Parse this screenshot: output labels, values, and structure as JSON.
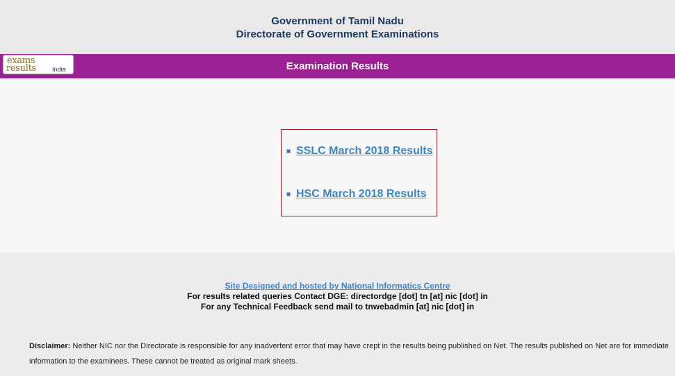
{
  "header": {
    "line1": "Government of Tamil Nadu",
    "line2": "Directorate of Government Examinations"
  },
  "logo": {
    "word1": "exams",
    "word2": "results",
    "word3": "India"
  },
  "banner": {
    "title": "Examination Results"
  },
  "results": {
    "links": [
      {
        "label": "SSLC March 2018 Results"
      },
      {
        "label": "HSC March 2018 Results"
      }
    ]
  },
  "footer": {
    "site_link": "Site Designed and hosted by National Informatics Centre",
    "contact_line": "For results related queries Contact DGE:  directordge [dot] tn [at] nic [dot] in",
    "feedback_line": "For any Technical Feedback send mail to tnwebadmin [at] nic [dot] in",
    "disclaimer_label": "Disclaimer:",
    "disclaimer_text": " Neither NIC nor the Directorate is responsible for any inadvertent error that may have crept in the results being published on Net. The results published on Net are for immediate information to the examinees. These cannot be treated as original mark sheets."
  },
  "colors": {
    "banner": "#9b2094",
    "link": "#3e85c2",
    "header_text": "#1c3a5e",
    "box_border": "#8b1a1a"
  }
}
